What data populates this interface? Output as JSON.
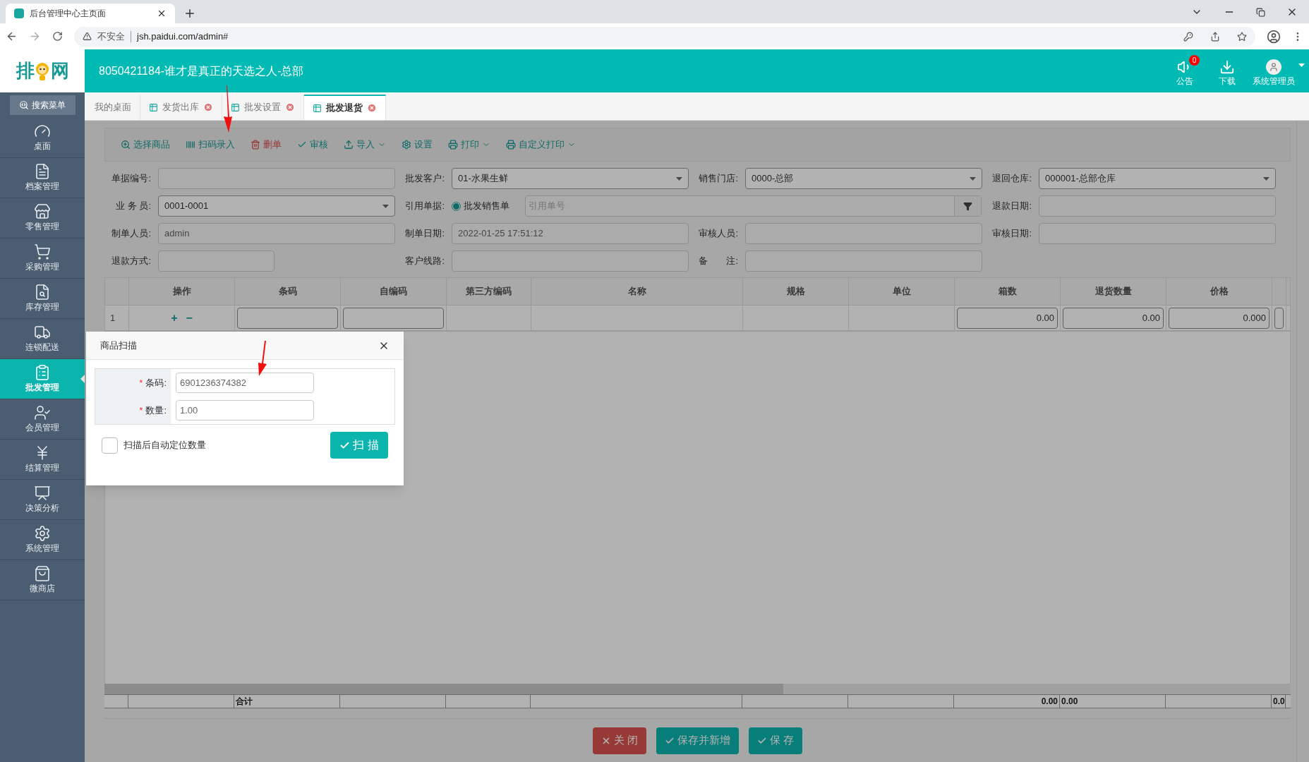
{
  "browser": {
    "tab_title": "后台管理中心主页面",
    "security": "不安全",
    "url": "jsh.paidui.com/admin#"
  },
  "header": {
    "logo_left": "排",
    "logo_right": "网",
    "title": "8050421184-谁才是真正的天选之人-总部",
    "actions": [
      {
        "label": "公告",
        "badge": "0",
        "dropdown": false
      },
      {
        "label": "下载",
        "dropdown": false
      },
      {
        "label": "系统管理员",
        "dropdown": true
      }
    ]
  },
  "sidebar": {
    "search": "搜索菜单",
    "items": [
      {
        "label": "桌面",
        "selected": false
      },
      {
        "label": "档案管理",
        "selected": false
      },
      {
        "label": "零售管理",
        "selected": false
      },
      {
        "label": "采购管理",
        "selected": false
      },
      {
        "label": "库存管理",
        "selected": false
      },
      {
        "label": "连锁配送",
        "selected": false
      },
      {
        "label": "批发管理",
        "selected": true
      },
      {
        "label": "会员管理",
        "selected": false
      },
      {
        "label": "结算管理",
        "selected": false
      },
      {
        "label": "决策分析",
        "selected": false
      },
      {
        "label": "系统管理",
        "selected": false
      },
      {
        "label": "微商店",
        "selected": false
      }
    ]
  },
  "tabs": [
    {
      "label": "我的桌面",
      "selected": false,
      "closable": false
    },
    {
      "label": "发货出库",
      "selected": false,
      "closable": true
    },
    {
      "label": "批发设置",
      "selected": false,
      "closable": true
    },
    {
      "label": "批发退货",
      "selected": true,
      "closable": true
    }
  ],
  "toolbar": [
    {
      "label": "选择商品",
      "kind": "normal",
      "dropdown": false
    },
    {
      "label": "扫码录入",
      "kind": "normal",
      "dropdown": false
    },
    {
      "label": "删单",
      "kind": "danger",
      "dropdown": false
    },
    {
      "label": "审核",
      "kind": "normal",
      "dropdown": false
    },
    {
      "label": "导入",
      "kind": "normal",
      "dropdown": true
    },
    {
      "label": "设置",
      "kind": "normal",
      "dropdown": false
    },
    {
      "label": "打印",
      "kind": "normal",
      "dropdown": true
    },
    {
      "label": "自定义打印",
      "kind": "normal",
      "dropdown": true
    }
  ],
  "form": [
    {
      "label": "单据编号:",
      "kind": "text"
    },
    {
      "label": "批发客户:",
      "kind": "select",
      "value": "01-水果生鲜"
    },
    {
      "label": "销售门店:",
      "kind": "select",
      "value": "0000-总部"
    },
    {
      "label": "退回仓库:",
      "kind": "select",
      "value": "000001-总部仓库"
    },
    {
      "label": "业 务 员:",
      "kind": "select",
      "value": "0001-0001"
    },
    {
      "label": "引用单据:",
      "kind": "lookup",
      "radio": {
        "label": "批发销售单",
        "selected": true
      },
      "placeholder": "引用单号"
    },
    {
      "label": "退款日期:",
      "kind": "text"
    },
    {
      "label": "制单人员:",
      "kind": "text",
      "value": "admin"
    },
    {
      "label": "制单日期:",
      "kind": "text",
      "value": "2022-01-25 17:51:12"
    },
    {
      "label": "审核人员:",
      "kind": "text"
    },
    {
      "label": "审核日期:",
      "kind": "text"
    },
    {
      "label": "退款方式:",
      "kind": "short"
    },
    {
      "label": "客户线路:",
      "kind": "text"
    },
    {
      "label": "备　　注:",
      "kind": "text"
    }
  ],
  "table": {
    "columns": [
      {
        "kind": "blank"
      },
      {
        "label": "操作",
        "kind": "text"
      },
      {
        "label": "条码",
        "kind": "text"
      },
      {
        "label": "自编码",
        "kind": "text"
      },
      {
        "label": "第三方编码",
        "kind": "text"
      },
      {
        "label": "名称",
        "kind": "text"
      },
      {
        "label": "规格",
        "kind": "text"
      },
      {
        "label": "单位",
        "kind": "text"
      },
      {
        "label": "箱数",
        "kind": "text"
      },
      {
        "label": "退货数量",
        "kind": "text"
      },
      {
        "label": "价格",
        "kind": "text"
      },
      {
        "kind": "blank"
      }
    ],
    "totals": [
      {
        "kind": "empty"
      },
      {
        "kind": "empty"
      },
      {
        "kind": "text",
        "text": "合计"
      },
      {
        "kind": "empty"
      },
      {
        "kind": "empty"
      },
      {
        "kind": "empty"
      },
      {
        "kind": "empty"
      },
      {
        "kind": "empty"
      },
      {
        "kind": "number",
        "text": "0.00"
      },
      {
        "kind": "text",
        "text": "0.00"
      },
      {
        "kind": "empty"
      },
      {
        "kind": "text",
        "text": "0.0"
      }
    ],
    "rows": [
      {
        "cells": [
          {
            "kind": "index",
            "text": "1"
          },
          {
            "kind": "actions",
            "add": "+",
            "remove": "−"
          },
          {
            "kind": "input"
          },
          {
            "kind": "input"
          },
          {
            "kind": "empty"
          },
          {
            "kind": "empty"
          },
          {
            "kind": "empty"
          },
          {
            "kind": "empty"
          },
          {
            "kind": "input",
            "value": "0.00"
          },
          {
            "kind": "input",
            "value": "0.00"
          },
          {
            "kind": "input",
            "value": "0.000"
          },
          {
            "kind": "input"
          }
        ]
      }
    ]
  },
  "footer": [
    {
      "label": "关 闭",
      "kind": "close"
    },
    {
      "label": "保存并新增",
      "kind": "save"
    },
    {
      "label": "保 存",
      "kind": "save"
    }
  ],
  "dialog": {
    "title": "商品扫描",
    "fields": [
      {
        "mark": "*",
        "label": "条码:",
        "value": "6901236374382"
      },
      {
        "mark": "*",
        "label": "数量:",
        "value": "1.00"
      }
    ],
    "checkbox": {
      "label": "扫描后自动定位数量",
      "checked": false
    },
    "button": "扫 描"
  }
}
